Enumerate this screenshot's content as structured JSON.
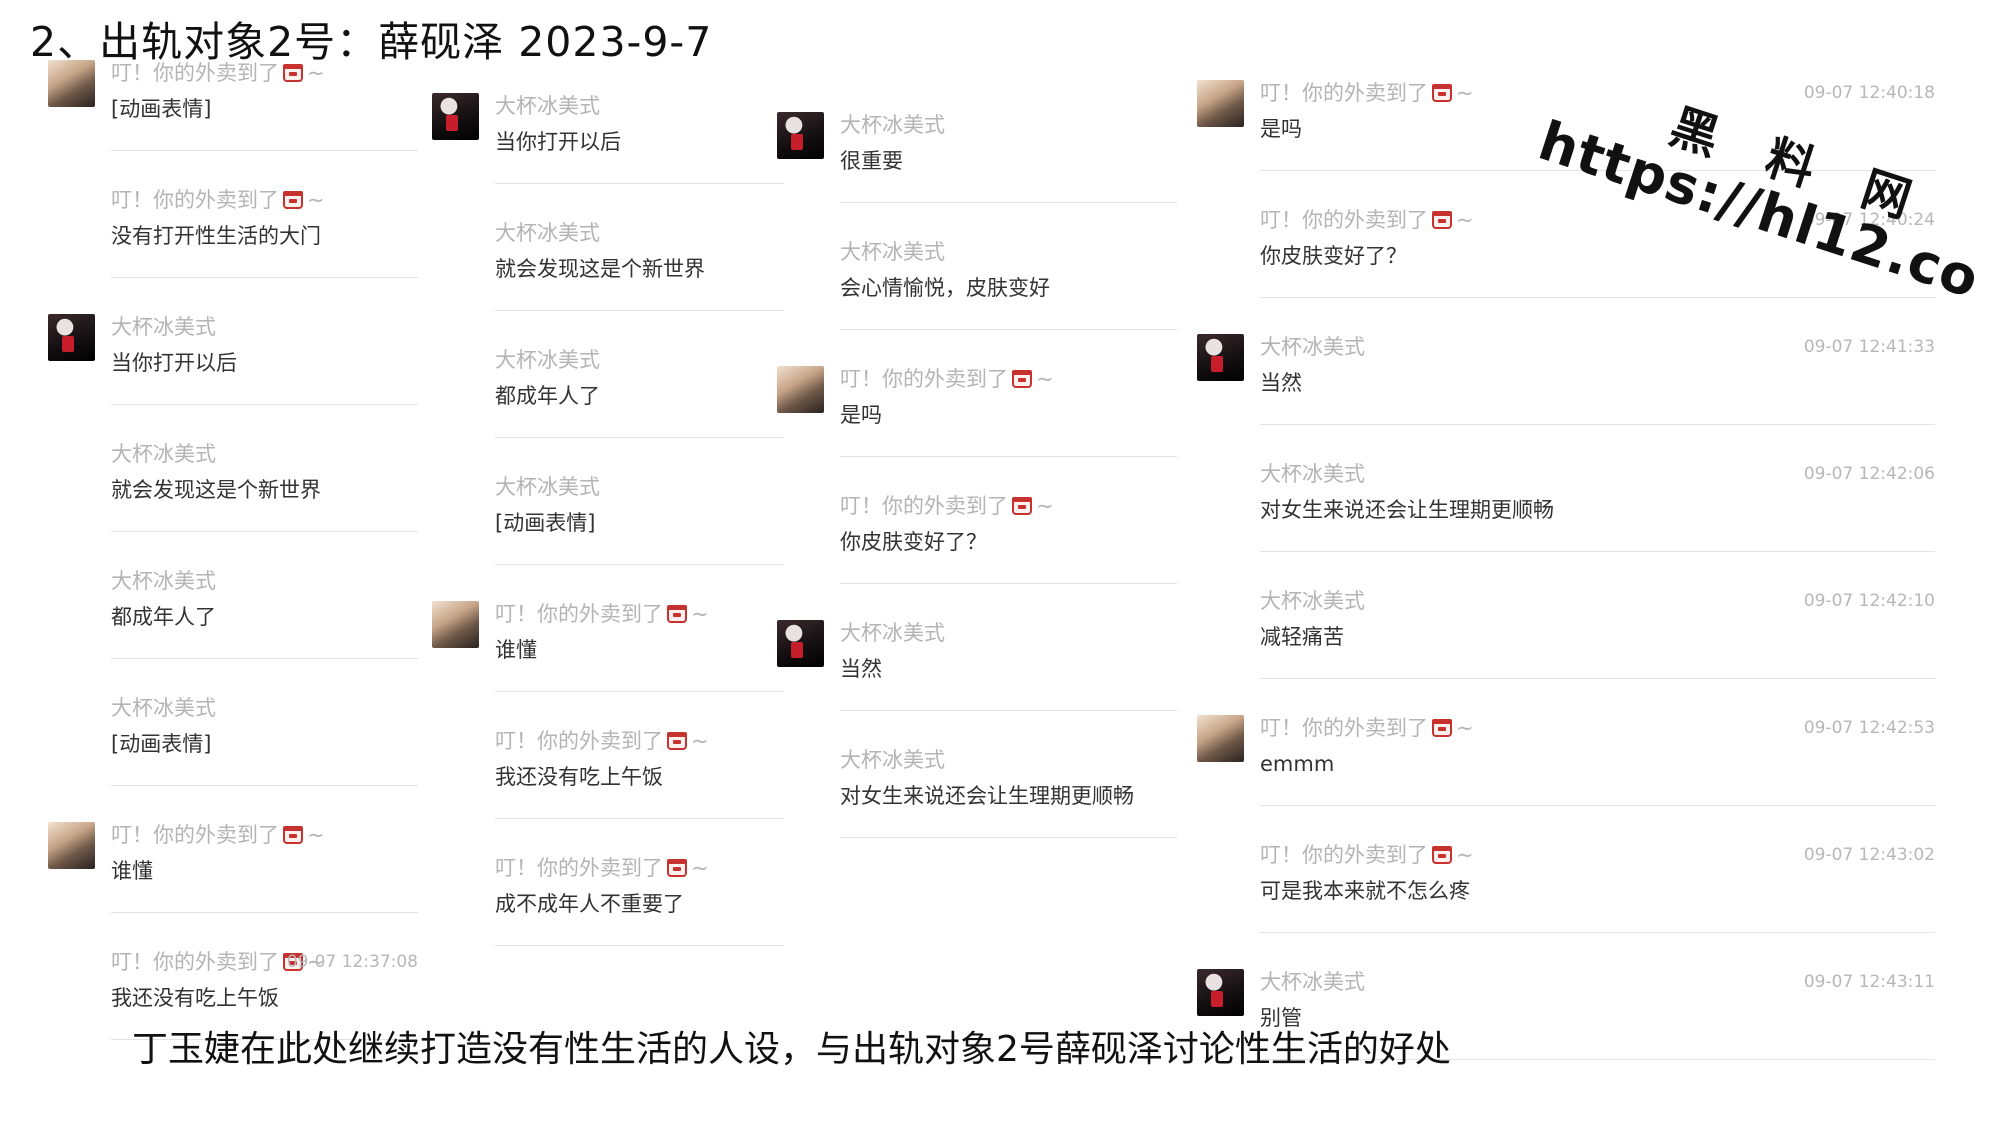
{
  "title": "2、出轨对象2号：薛砚泽  2023-9-7",
  "caption": "丁玉婕在此处继续打造没有性生活的人设，与出轨对象2号薛砚泽讨论性生活的好处",
  "watermark": {
    "name": "黑 料 网",
    "url": "https://hl12.co"
  },
  "columns": [
    {
      "messages": [
        {
          "sender": "叮！你的外卖到了",
          "emoji": true,
          "body": "[动画表情]",
          "time": "",
          "avatar": true,
          "gender": "female"
        },
        {
          "sender": "叮！你的外卖到了",
          "emoji": true,
          "body": "没有打开性生活的大门",
          "time": "",
          "avatar": false,
          "gender": "female"
        },
        {
          "sender": "大杯冰美式",
          "emoji": false,
          "body": "当你打开以后",
          "time": "",
          "avatar": true,
          "gender": "male"
        },
        {
          "sender": "大杯冰美式",
          "emoji": false,
          "body": "就会发现这是个新世界",
          "time": "",
          "avatar": false,
          "gender": "male"
        },
        {
          "sender": "大杯冰美式",
          "emoji": false,
          "body": "都成年人了",
          "time": "",
          "avatar": false,
          "gender": "male"
        },
        {
          "sender": "大杯冰美式",
          "emoji": false,
          "body": "[动画表情]",
          "time": "",
          "avatar": false,
          "gender": "male"
        },
        {
          "sender": "叮！你的外卖到了",
          "emoji": true,
          "body": "谁懂",
          "time": "",
          "avatar": true,
          "gender": "female"
        },
        {
          "sender": "叮！你的外卖到了",
          "emoji": true,
          "body": "我还没有吃上午饭",
          "time": "09-07 12:37:08",
          "avatar": false,
          "gender": "female"
        }
      ]
    },
    {
      "messages": [
        {
          "sender": "大杯冰美式",
          "emoji": false,
          "body": "当你打开以后",
          "time": "",
          "avatar": true,
          "gender": "male"
        },
        {
          "sender": "大杯冰美式",
          "emoji": false,
          "body": "就会发现这是个新世界",
          "time": "",
          "avatar": false,
          "gender": "male"
        },
        {
          "sender": "大杯冰美式",
          "emoji": false,
          "body": "都成年人了",
          "time": "",
          "avatar": false,
          "gender": "male"
        },
        {
          "sender": "大杯冰美式",
          "emoji": false,
          "body": "[动画表情]",
          "time": "",
          "avatar": false,
          "gender": "male"
        },
        {
          "sender": "叮！你的外卖到了",
          "emoji": true,
          "body": "谁懂",
          "time": "",
          "avatar": true,
          "gender": "female"
        },
        {
          "sender": "叮！你的外卖到了",
          "emoji": true,
          "body": "我还没有吃上午饭",
          "time": "",
          "avatar": false,
          "gender": "female"
        },
        {
          "sender": "叮！你的外卖到了",
          "emoji": true,
          "body": "成不成年人不重要了",
          "time": "",
          "avatar": false,
          "gender": "female"
        }
      ]
    },
    {
      "messages": [
        {
          "sender": "大杯冰美式",
          "emoji": false,
          "body": "很重要",
          "time": "",
          "avatar": true,
          "gender": "male"
        },
        {
          "sender": "大杯冰美式",
          "emoji": false,
          "body": "会心情愉悦，皮肤变好",
          "time": "",
          "avatar": false,
          "gender": "male"
        },
        {
          "sender": "叮！你的外卖到了",
          "emoji": true,
          "body": "是吗",
          "time": "",
          "avatar": true,
          "gender": "female"
        },
        {
          "sender": "叮！你的外卖到了",
          "emoji": true,
          "body": "你皮肤变好了？",
          "time": "",
          "avatar": false,
          "gender": "female"
        },
        {
          "sender": "大杯冰美式",
          "emoji": false,
          "body": "当然",
          "time": "",
          "avatar": true,
          "gender": "male"
        },
        {
          "sender": "大杯冰美式",
          "emoji": false,
          "body": "对女生来说还会让生理期更顺畅",
          "time": "",
          "avatar": false,
          "gender": "male"
        }
      ]
    },
    {
      "messages": [
        {
          "sender": "叮！你的外卖到了",
          "emoji": true,
          "body": "是吗",
          "time": "09-07 12:40:18",
          "avatar": true,
          "gender": "female"
        },
        {
          "sender": "叮！你的外卖到了",
          "emoji": true,
          "body": "你皮肤变好了？",
          "time": "09-07 12:40:24",
          "avatar": false,
          "gender": "female"
        },
        {
          "sender": "大杯冰美式",
          "emoji": false,
          "body": "当然",
          "time": "09-07 12:41:33",
          "avatar": true,
          "gender": "male"
        },
        {
          "sender": "大杯冰美式",
          "emoji": false,
          "body": "对女生来说还会让生理期更顺畅",
          "time": "09-07 12:42:06",
          "avatar": false,
          "gender": "male"
        },
        {
          "sender": "大杯冰美式",
          "emoji": false,
          "body": "减轻痛苦",
          "time": "09-07 12:42:10",
          "avatar": false,
          "gender": "male"
        },
        {
          "sender": "叮！你的外卖到了",
          "emoji": true,
          "body": "emmm",
          "time": "09-07 12:42:53",
          "avatar": true,
          "gender": "female"
        },
        {
          "sender": "叮！你的外卖到了",
          "emoji": true,
          "body": "可是我本来就不怎么疼",
          "time": "09-07 12:43:02",
          "avatar": false,
          "gender": "female"
        },
        {
          "sender": "大杯冰美式",
          "emoji": false,
          "body": "别管",
          "time": "09-07 12:43:11",
          "avatar": true,
          "gender": "male"
        }
      ]
    }
  ]
}
